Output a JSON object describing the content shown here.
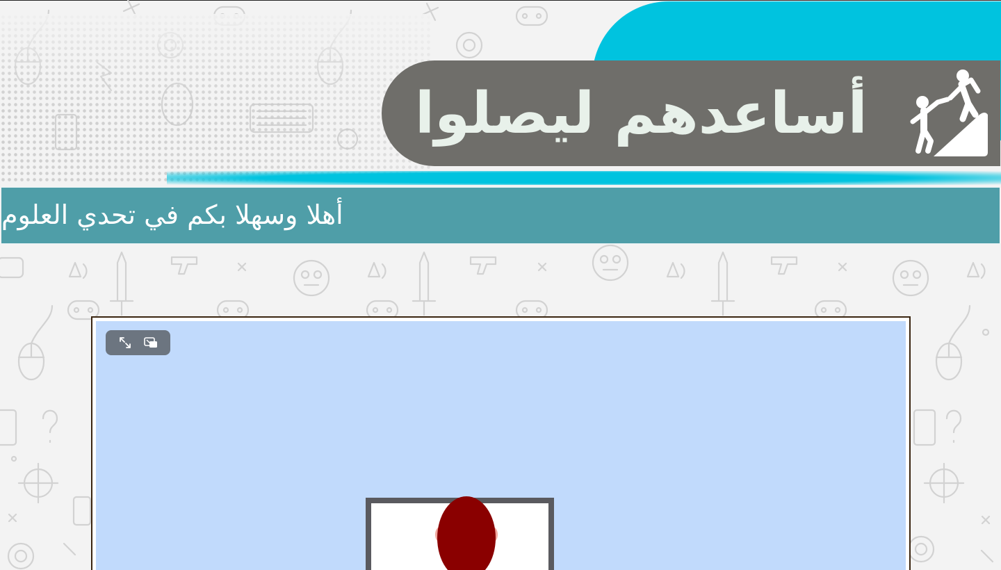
{
  "header": {
    "title": "أساعدهم ليصلوا",
    "logo_icon": "climbing-helper-icon",
    "colors": {
      "accent": "#00c3df",
      "title_bar": "#6f6e6a",
      "title_text": "#e8f1ea"
    }
  },
  "welcome": {
    "text": "أهلا وسهلا بكم في تحدي العلوم",
    "color": "#4f9ea8"
  },
  "game": {
    "controls": [
      {
        "name": "fullscreen-icon"
      },
      {
        "name": "picture-in-picture-icon"
      }
    ],
    "background": "#c1dafc"
  }
}
